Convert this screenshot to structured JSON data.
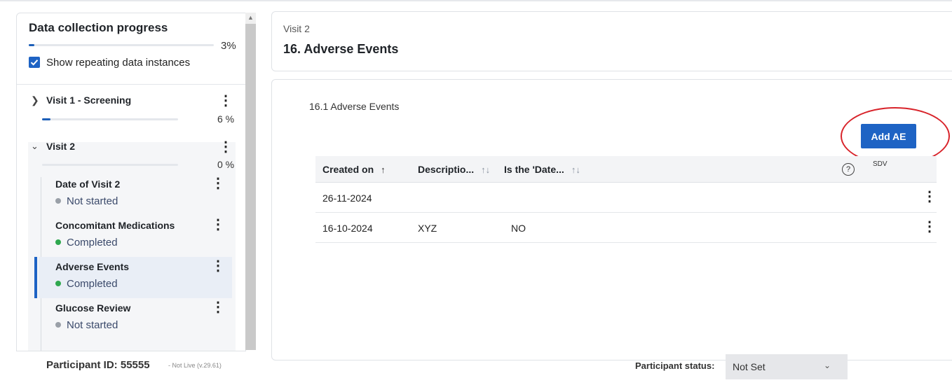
{
  "sidebar": {
    "title": "Data collection progress",
    "progress_pct": "3%",
    "progress_value": 3,
    "show_repeating_label": "Show repeating data instances",
    "visits": [
      {
        "label": "Visit 1 - Screening",
        "pct": "6 %",
        "progress_value": 6,
        "expanded": false
      },
      {
        "label": "Visit 2",
        "pct": "0 %",
        "progress_value": 0,
        "expanded": true
      }
    ],
    "items": [
      {
        "title": "Date of Visit 2",
        "status": "Not started",
        "status_color": "#9aa0a8"
      },
      {
        "title": "Concomitant Medications",
        "status": "Completed",
        "status_color": "#2fa84f"
      },
      {
        "title": "Adverse Events",
        "status": "Completed",
        "status_color": "#2fa84f"
      },
      {
        "title": "Glucose Review",
        "status": "Not started",
        "status_color": "#9aa0a8"
      }
    ]
  },
  "header": {
    "visit": "Visit 2",
    "title": "16. Adverse Events"
  },
  "main": {
    "section_label": "16.1  Adverse Events",
    "add_button": "Add AE",
    "table": {
      "columns": [
        "Created on",
        "Descriptio...",
        "Is the 'Date..."
      ],
      "sort_icons": [
        "↑",
        "↑↓",
        "↑↓"
      ],
      "help_icon": "?",
      "sdv_icon": "SDV",
      "rows": [
        [
          "26-11-2024",
          "",
          ""
        ],
        [
          "16-10-2024",
          "XYZ",
          "NO"
        ]
      ]
    }
  },
  "footer": {
    "participant_id": "Participant ID: 55555",
    "version": "- Not Live (v.29.61)",
    "status_label": "Participant status:",
    "status_value": "Not Set"
  },
  "colors": {
    "accent": "#1e63c4",
    "completed": "#2fa84f",
    "not_started": "#9aa0a8",
    "annotation": "#d8232a"
  },
  "icons": {
    "expand_collapsed": "chevron-right-icon",
    "expand_open": "chevron-down-icon",
    "menu": "kebab-menu-icon",
    "help": "help-circle-icon",
    "sdv": "sdv-icon",
    "dropdown": "chevron-down-icon"
  }
}
